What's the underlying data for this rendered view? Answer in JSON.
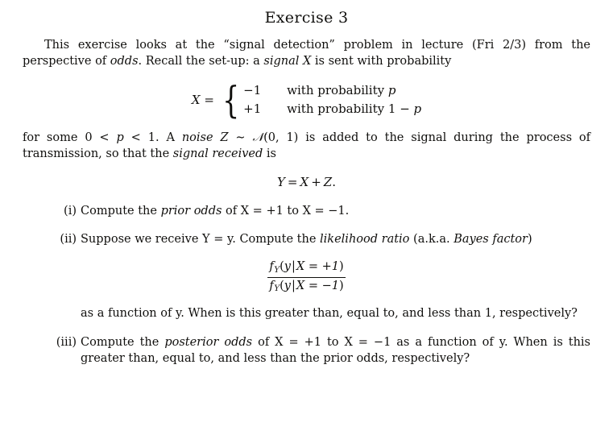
{
  "document": {
    "title": "Exercise 3",
    "intro": {
      "line": "This exercise looks at the “signal detection” problem in lecture (Fri 2/3) from the perspective of ",
      "emphasis": "odds",
      "tail": ". Recall the set-up: a ",
      "emphasis2": "signal",
      "variable": "X",
      "tail2": " is sent with probability"
    },
    "piecewise": {
      "lhs_var": "X",
      "lhs_eq": "=",
      "brace": "{",
      "rows": [
        {
          "value": "−1",
          "text": "with probability ",
          "param": "p"
        },
        {
          "value": "+1",
          "text": "with probability 1 − ",
          "param": "p"
        }
      ]
    },
    "noise_para": {
      "part1": "for some 0 < ",
      "p": "p",
      "part2": " < 1. A ",
      "noise_em": "noise",
      "z": "Z",
      "tilde": " ∼ ",
      "normal": "𝒩",
      "normal_args": "(0, 1)",
      "part3": " is added to the signal during the process of transmission, so that the ",
      "signal_em": "signal received",
      "part4": " is"
    },
    "equation_y": {
      "lhs": "Y",
      "eq": "=",
      "rhs1": "X",
      "plus": "+",
      "rhs2": "Z",
      "period": "."
    },
    "items": [
      {
        "marker": "(i)",
        "text_before": "Compute the ",
        "emphasis": "prior odds",
        "text_after": " of X = +1 to X = −1."
      },
      {
        "marker": "(ii)",
        "text_before": "Suppose we receive Y = y. Compute the ",
        "emphasis": "likelihood ratio",
        "text_mid": " (a.k.a. ",
        "emphasis2": "Bayes factor",
        "text_after": ")"
      },
      {
        "marker": "(iii)",
        "text_before": "Compute the ",
        "emphasis": "posterior odds",
        "text_after": " of X = +1 to X = −1 as a function of y. When is this greater than, equal to, and less than the prior odds, respectively?"
      }
    ],
    "likelihood_fraction": {
      "numerator": {
        "f": "f",
        "sub": "Y",
        "open": "(",
        "arg": "y",
        "bar": "|",
        "cond": "X = +1",
        "close": ")"
      },
      "denominator": {
        "f": "f",
        "sub": "Y",
        "open": "(",
        "arg": "y",
        "bar": "|",
        "cond": "X = −1",
        "close": ")"
      }
    },
    "continuation": "as a function of y. When is this greater than, equal to, and less than 1, respectively?"
  }
}
